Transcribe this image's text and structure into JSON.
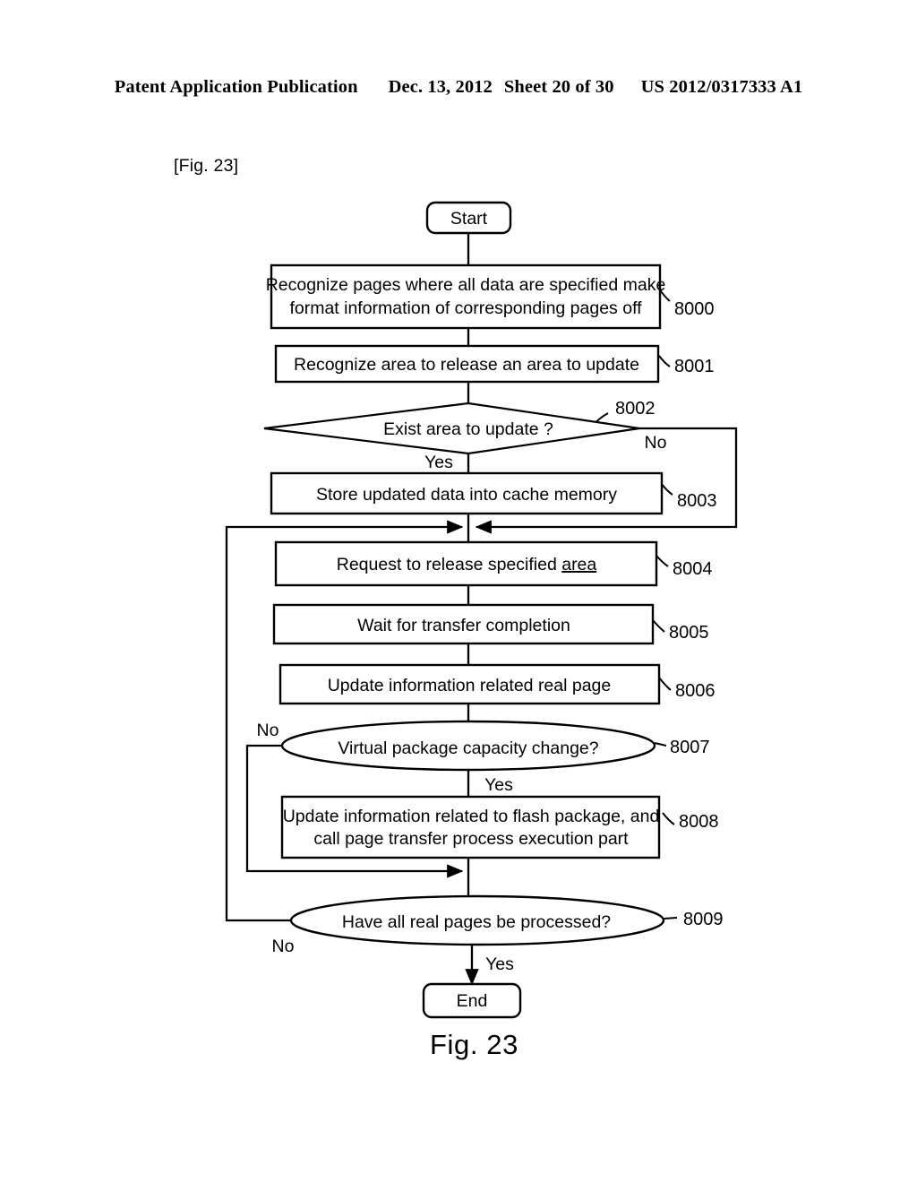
{
  "header": {
    "publication": "Patent Application Publication",
    "date": "Dec. 13, 2012",
    "sheet": "Sheet 20 of 30",
    "number": "US 2012/0317333 A1"
  },
  "figure": {
    "tag": "[Fig. 23]",
    "caption": "Fig. 23"
  },
  "terminators": {
    "start": "Start",
    "end": "End"
  },
  "edge_labels": {
    "yes": "Yes",
    "no": "No"
  },
  "chart_data": {
    "type": "diagram",
    "title": "Fig. 23",
    "nodes": [
      {
        "id": "start",
        "shape": "rounded-rect",
        "text": "Start",
        "ref": ""
      },
      {
        "id": "8000",
        "shape": "rect",
        "text": "Recognize pages where all data are specified make format information of corresponding pages off",
        "line1": "Recognize pages where all data are specified make",
        "line2": "format information of corresponding pages off",
        "ref": "8000"
      },
      {
        "id": "8001",
        "shape": "rect",
        "text": "Recognize area to release an area to update",
        "line1": "Recognize area to release an area to update",
        "line2": "",
        "ref": "8001"
      },
      {
        "id": "8002",
        "shape": "diamond",
        "text": "Exist area to update ?",
        "line1": "Exist area to update ?",
        "line2": "",
        "ref": "8002"
      },
      {
        "id": "8003",
        "shape": "rect",
        "text": "Store updated data into cache memory",
        "line1": "Store updated data into cache memory",
        "line2": "",
        "ref": "8003"
      },
      {
        "id": "8004",
        "shape": "rect",
        "text": "Request to release specified area",
        "line1": "Request to release specified ",
        "line2": "area ",
        "ref": "8004"
      },
      {
        "id": "8005",
        "shape": "rect",
        "text": "Wait for transfer completion",
        "line1": "Wait for transfer completion",
        "line2": "",
        "ref": "8005"
      },
      {
        "id": "8006",
        "shape": "rect",
        "text": "Update information related real page",
        "line1": "Update information related real page",
        "line2": "",
        "ref": "8006"
      },
      {
        "id": "8007",
        "shape": "ellipse",
        "text": "Virtual package capacity change?",
        "line1": "Virtual package capacity change?",
        "line2": "",
        "ref": "8007"
      },
      {
        "id": "8008",
        "shape": "rect",
        "text": "Update information related to flash package, and call page transfer  process execution part",
        "line1": "Update information related to flash package, and",
        "line2": "call page transfer  process execution part",
        "ref": "8008"
      },
      {
        "id": "8009",
        "shape": "ellipse",
        "text": "Have all real pages be processed?",
        "line1": "Have all real pages be processed?",
        "line2": "",
        "ref": "8009"
      },
      {
        "id": "end",
        "shape": "rounded-rect",
        "text": "End",
        "ref": ""
      }
    ],
    "edges": [
      {
        "from": "start",
        "to": "8000",
        "label": ""
      },
      {
        "from": "8000",
        "to": "8001",
        "label": ""
      },
      {
        "from": "8001",
        "to": "8002",
        "label": ""
      },
      {
        "from": "8002",
        "to": "8003",
        "label": "Yes"
      },
      {
        "from": "8002",
        "to": "8004",
        "label": "No"
      },
      {
        "from": "8003",
        "to": "8004",
        "label": ""
      },
      {
        "from": "8004",
        "to": "8005",
        "label": ""
      },
      {
        "from": "8005",
        "to": "8006",
        "label": ""
      },
      {
        "from": "8006",
        "to": "8007",
        "label": ""
      },
      {
        "from": "8007",
        "to": "8008",
        "label": "Yes"
      },
      {
        "from": "8007",
        "to": "8009",
        "label": "No"
      },
      {
        "from": "8008",
        "to": "8009",
        "label": ""
      },
      {
        "from": "8009",
        "to": "end",
        "label": "Yes"
      },
      {
        "from": "8009",
        "to": "8004",
        "label": "No"
      }
    ]
  }
}
